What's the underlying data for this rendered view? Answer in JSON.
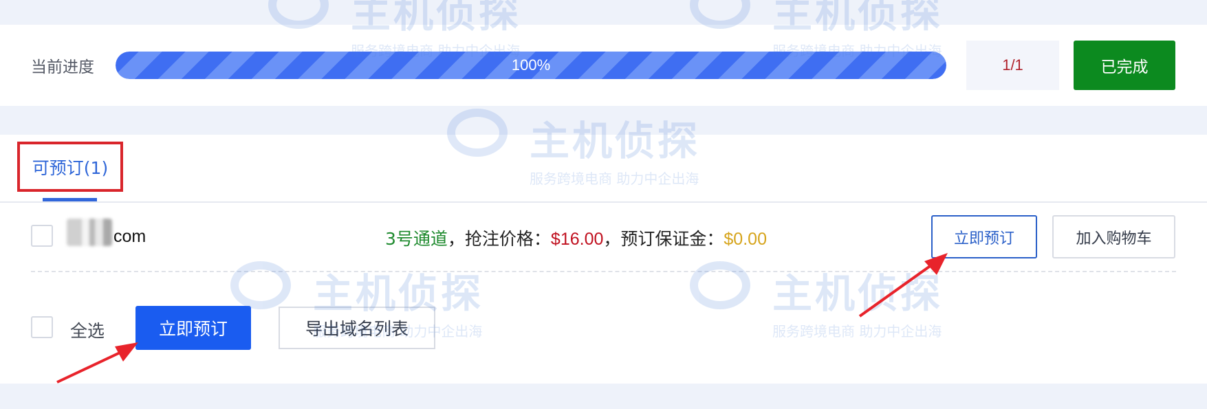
{
  "progress": {
    "label": "当前进度",
    "percent_text": "100%",
    "value": 1.0
  },
  "page_count": "1/1",
  "status_button": "已完成",
  "tab": {
    "label": "可预订(1)"
  },
  "item": {
    "domain_suffix": "com",
    "channel": "3号通道",
    "sep1": "，抢注价格：",
    "price": "$16.00",
    "sep2": "，预订保证金：",
    "deposit": "$0.00",
    "reserve_label": "立即预订",
    "add_cart_label": "加入购物车"
  },
  "footer": {
    "select_all_label": "全选",
    "bulk_reserve_label": "立即预订",
    "export_label": "导出域名列表"
  },
  "watermark": {
    "brand": "主机侦探",
    "slogan": "服务跨境电商 助力中企出海"
  },
  "colors": {
    "accent": "#1a5cf0",
    "success": "#0c8a1f",
    "highlight": "#d9252b",
    "price": "#c0101f",
    "deposit": "#d6a41b",
    "channel": "#1e8a2e"
  }
}
